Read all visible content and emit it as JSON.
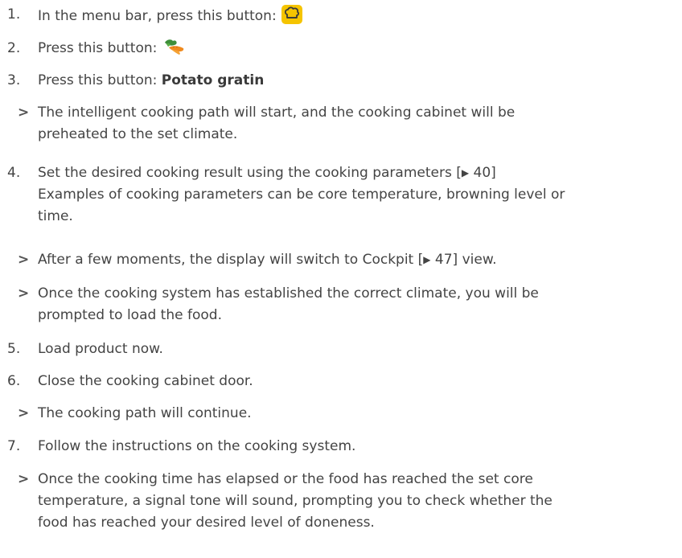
{
  "steps": [
    {
      "marker": "1.",
      "text": "In the menu bar, press this button:",
      "icon": "chef-hat-icon"
    },
    {
      "marker": "2.",
      "text": "Press this button:",
      "icon": "vegetables-icon"
    },
    {
      "marker": "3.",
      "text": "Press this button:",
      "bold": "Potato gratin"
    },
    {
      "marker": ">",
      "line1": "The intelligent cooking path will start, and the cooking cabinet will be",
      "line2": "preheated to the set climate."
    },
    {
      "marker": "4.",
      "line1_pre": "Set the desired cooking result using the cooking parameters [",
      "line1_arrow": "▶",
      "line1_num": " 40]",
      "line2": "Examples of cooking parameters can be core temperature, browning level or",
      "line3": "time."
    },
    {
      "marker": ">",
      "pre": "After a few moments, the display will switch to Cockpit [",
      "arrow": "▶",
      "num": " 47]",
      "post": " view."
    },
    {
      "marker": ">",
      "line1": "Once the cooking system has established the correct climate, you will be",
      "line2": "prompted to load the food."
    },
    {
      "marker": "5.",
      "text": "Load product now."
    },
    {
      "marker": "6.",
      "text": "Close the cooking cabinet door."
    },
    {
      "marker": ">",
      "text": "The cooking path will continue."
    },
    {
      "marker": "7.",
      "text": "Follow the instructions on the cooking system."
    },
    {
      "marker": ">",
      "line1": "Once the cooking time has elapsed or the food has reached the set core",
      "line2": "temperature, a signal tone will sound, prompting you to check whether the",
      "line3": "food has reached your desired level of doneness."
    }
  ],
  "colors": {
    "button_yellow": "#F5C400",
    "text": "#444444",
    "carrot": "#F08A1E",
    "leaf": "#3E8E3A"
  }
}
